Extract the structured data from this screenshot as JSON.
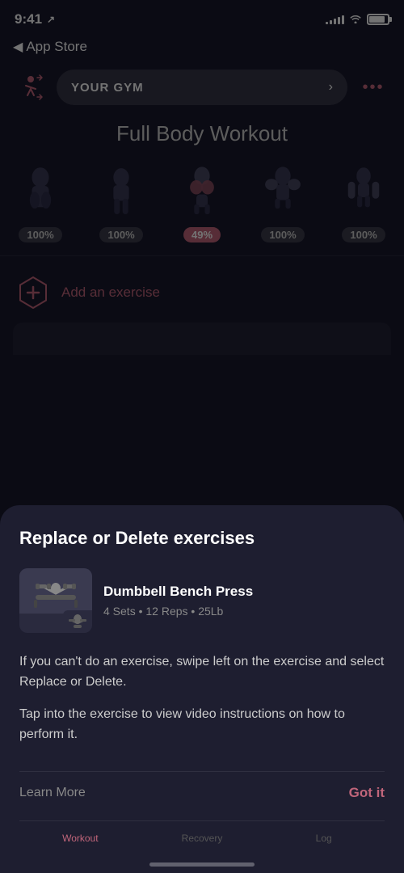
{
  "statusBar": {
    "time": "9:41",
    "locationIconLabel": "location-arrow",
    "signalBars": [
      3,
      5,
      7,
      9,
      11
    ],
    "batteryPercent": 85
  },
  "navigation": {
    "backLabel": "App Store"
  },
  "gymButton": {
    "label": "YOUR GYM",
    "arrowLabel": "›"
  },
  "workout": {
    "title": "Full Body Workout",
    "muscleGroups": [
      {
        "id": "back",
        "pct": "100%",
        "active": false
      },
      {
        "id": "legs",
        "pct": "100%",
        "active": false
      },
      {
        "id": "chest",
        "pct": "49%",
        "active": true
      },
      {
        "id": "shoulders",
        "pct": "100%",
        "active": false
      },
      {
        "id": "arms",
        "pct": "100%",
        "active": false
      }
    ]
  },
  "addExercise": {
    "label": "Add an exercise"
  },
  "bottomSheet": {
    "title": "Replace or Delete exercises",
    "exercise": {
      "name": "Dumbbell Bench Press",
      "meta": "4 Sets • 12 Reps • 25Lb"
    },
    "description1": "If you can't do an exercise, swipe left on the exercise and select Replace or Delete.",
    "description2": "Tap into the exercise to view video instructions on how to perform it.",
    "learnMoreLabel": "Learn More",
    "gotItLabel": "Got it"
  },
  "tabBar": {
    "tabs": [
      {
        "id": "workout",
        "label": "Workout",
        "active": true
      },
      {
        "id": "recovery",
        "label": "Recovery",
        "active": false
      },
      {
        "id": "log",
        "label": "Log",
        "active": false
      }
    ]
  },
  "colors": {
    "accent": "#c0657a",
    "background": "#1a1a2e",
    "card": "#1e1e30"
  }
}
